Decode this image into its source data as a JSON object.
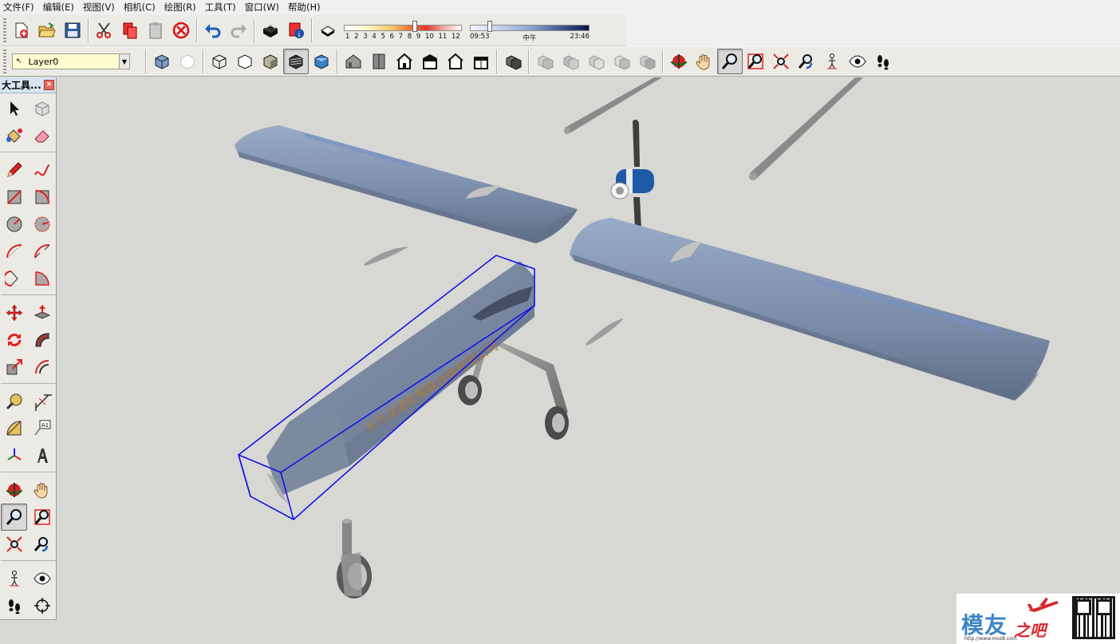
{
  "menu": [
    {
      "label": "文件(F)"
    },
    {
      "label": "编辑(E)"
    },
    {
      "label": "视图(V)"
    },
    {
      "label": "相机(C)"
    },
    {
      "label": "绘图(R)"
    },
    {
      "label": "工具(T)"
    },
    {
      "label": "窗口(W)"
    },
    {
      "label": "帮助(H)"
    }
  ],
  "shadow": {
    "months": [
      "1",
      "2",
      "3",
      "4",
      "5",
      "6",
      "7",
      "8",
      "9",
      "10",
      "11",
      "12"
    ],
    "time_start": "09:53",
    "time_mid": "中午",
    "time_end": "23:46"
  },
  "layer": {
    "name": "Layer0"
  },
  "palette": {
    "title": "大工具..."
  },
  "viewport": {
    "fuselage_text": "东方泌道航模联合体有限公司"
  },
  "watermark": {
    "brand_main": "模友",
    "brand_suffix": "之吧",
    "url": "http://www.moz8.com"
  },
  "colors": {
    "background": "#d7d7d3",
    "wing": "#8094b4",
    "selection": "#1414e6",
    "brand_blue": "#3b86c6",
    "brand_red": "#d8262a"
  }
}
